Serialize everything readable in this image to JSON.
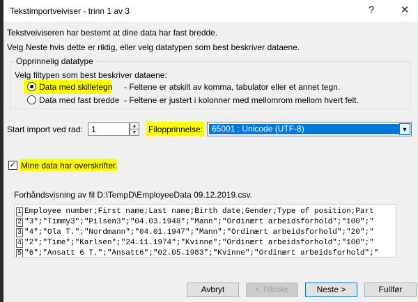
{
  "window": {
    "title": "Tekstimportveiviser - trinn 1 av 3",
    "help_glyph": "?",
    "close_glyph": "✕"
  },
  "intro": {
    "line1": "Tekstveiviseren har bestemt at dine data har fast bredde.",
    "line2": "Velg Neste hvis dette er riktig, eller velg datatypen som best beskriver dataene."
  },
  "datatype": {
    "group_title": "Opprinnelig datatype",
    "prompt": "Velg filtypen som best beskriver dataene:",
    "options": [
      {
        "label": "Data med skilletegn",
        "desc": "- Feltene er atskilt av komma, tabulator eller et annet tegn.",
        "selected": true
      },
      {
        "label": "Data med fast bredde",
        "desc": "- Feltene er justert i kolonner med mellomrom mellom hvert felt.",
        "selected": false
      }
    ]
  },
  "start_row": {
    "label": "Start import ved rad:",
    "value": "1"
  },
  "file_origin": {
    "label": "Filopprinnelse:",
    "value": "65001 : Unicode (UTF-8)"
  },
  "headers_checkbox": {
    "label": "Mine data har overskrifter.",
    "checked": true
  },
  "preview": {
    "title": "Forhåndsvisning av fil D:\\TempD\\EmployeeData 09.12.2019.csv.",
    "lines": [
      {
        "num": "1",
        "text": "Employee number;First name;Last name;Birth date;Gender;Type of position;Part"
      },
      {
        "num": "2",
        "text": "\"3\";\"Timmy3\";\"Pilsen3\";\"04.03.1948\";\"Mann\";\"Ordinært arbeidsforhold\";\"100\";\""
      },
      {
        "num": "3",
        "text": "\"4\";\"Ola T.\";\"Nordmann\";\"04.01.1947\";\"Mann\";\"Ordinært arbeidsforhold\";\"20\";\""
      },
      {
        "num": "4",
        "text": "\"2\";\"Time\";\"Karlsen\";\"24.11.1974\";\"Kvinne\";\"Ordinært arbeidsforhold\";\"100\";\""
      },
      {
        "num": "5",
        "text": "\"6\";\"Ansatt 6 T.\";\"Ansatt6\";\"02.05.1983\";\"Kvinne\";\"Ordinært arbeidsforhold\";\""
      }
    ]
  },
  "buttons": {
    "cancel": "Avbryt",
    "back": "< Tilbake",
    "next": "Neste >",
    "finish": "Fullfør"
  },
  "colors": {
    "highlight": "#ffff00",
    "accent": "#0078d7"
  }
}
